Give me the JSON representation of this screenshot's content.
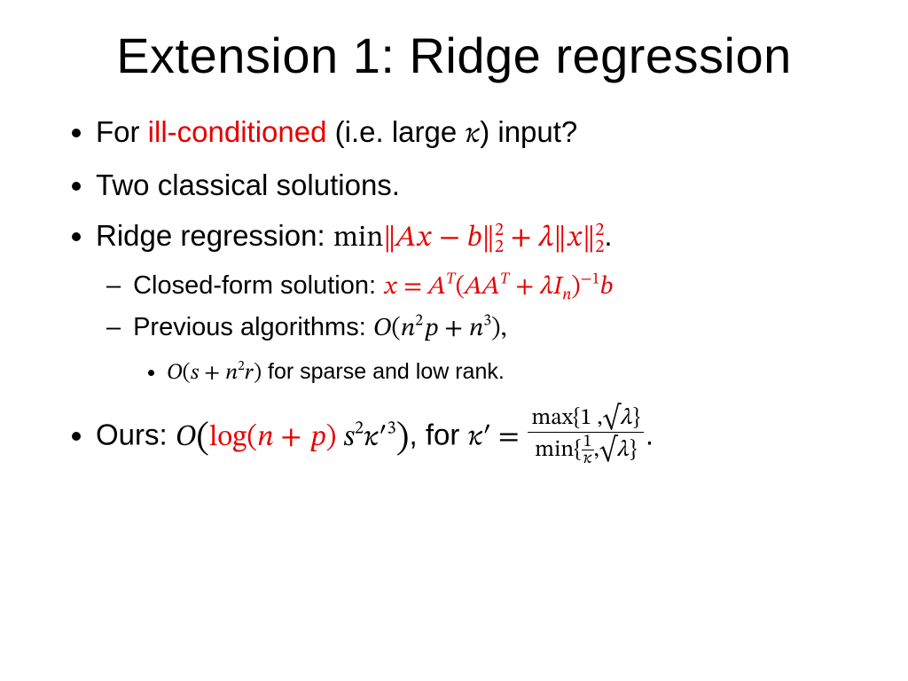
{
  "title": "Extension 1: Ridge regression",
  "b1": {
    "pre": "For ",
    "hl": "ill-conditioned",
    "mid": " (i.e. large ",
    "kappa": "𝜅",
    "post": ") input?"
  },
  "b2": "Two classical solutions.",
  "b3": {
    "label": "Ridge regression: ",
    "min": "min",
    "expr_l": "‖𝐴𝑥 − 𝑏‖",
    "plus": " + 𝜆",
    "expr_r": "‖𝑥‖",
    "sup": "2",
    "sub": "2",
    "period": "."
  },
  "b3a": {
    "label": "Closed-form solution: ",
    "expr": "𝑥 = 𝐴",
    "tsup": "𝑇",
    "mid": "(𝐴𝐴",
    "tsup2": "𝑇",
    "mid2": " + 𝜆𝐼",
    "nsub": "𝑛",
    "tail": ")",
    "inv": "−1",
    "b": "𝑏"
  },
  "b3b": {
    "label": "Previous algorithms: ",
    "expr": "𝑂(𝑛",
    "sq": "2",
    "mid": "𝑝 + 𝑛",
    "cube": "3",
    "close": "),"
  },
  "b3bi": {
    "pre": "𝑂(𝑠 + 𝑛",
    "sq": "2",
    "post": "𝑟)",
    "tail": " for sparse and low rank."
  },
  "b4": {
    "label": "Ours: ",
    "o": "𝑂",
    "lp": "(",
    "log": "log(𝑛 + 𝑝)",
    "sp": " 𝑠",
    "sq": "2",
    "kp": "𝜅′",
    "cube": "3",
    "rp": ")",
    "mid": ", for ",
    "kpeq": "𝜅′ = ",
    "num": "max{1 ,√𝜆}",
    "den_l": "min{",
    "den_f_n": "1",
    "den_f_d": "𝜅",
    "den_r": ",√𝜆}",
    "period": "."
  }
}
